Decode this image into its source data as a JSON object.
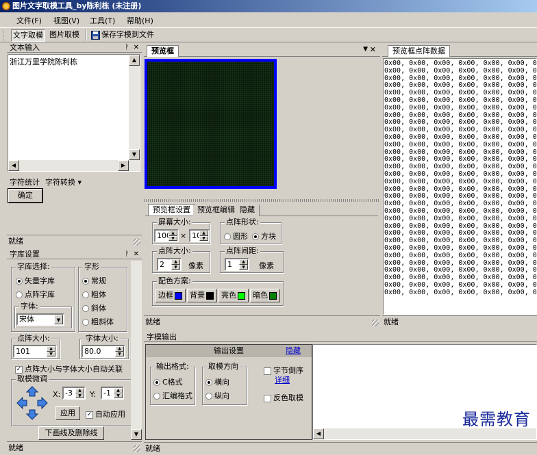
{
  "window": {
    "title": "图片文字取模工具_by陈利栋 (未注册)"
  },
  "menu": [
    "文件(F)",
    "视图(V)",
    "工具(T)",
    "帮助(H)"
  ],
  "toolbar": {
    "btn1": "文字取模",
    "btn2": "图片取模",
    "btn3": "保存字模到文件"
  },
  "text_input": {
    "title": "文本输入",
    "value": "浙江万里学院陈利栋",
    "stat_label": "字符统计",
    "convert_label": "字符转换",
    "ok": "确定",
    "status": "就绪"
  },
  "font_settings": {
    "title": "字库设置",
    "lib_group": "字库选择:",
    "lib_options": [
      "矢量字库",
      "点阵字库"
    ],
    "font_group": "字体:",
    "font_value": "宋体",
    "style_group": "字形",
    "style_options": [
      "常规",
      "粗体",
      "斜体",
      "粗斜体"
    ],
    "dot_size_label": "点阵大小:",
    "dot_size_value": "101",
    "font_size_label": "字体大小:",
    "font_size_value": "80.0",
    "auto_link": "点阵大小与字体大小自动关联",
    "fine_tune": "取模微调",
    "x_label": "X:",
    "x_value": "-3",
    "y_label": "Y:",
    "y_value": "-1",
    "apply": "应用",
    "auto_apply": "自动应用",
    "underline_btn": "下画线及删除线",
    "status": "就绪"
  },
  "preview": {
    "tab": "预览框",
    "status": "就绪",
    "settings_tabs": [
      "预览框设置",
      "预览框编辑",
      "隐藏"
    ],
    "screen_size_label": "屏幕大小:",
    "screen_w": "100",
    "screen_h": "100",
    "times": "×",
    "dot_shape_label": "点阵形状:",
    "dot_shapes": [
      "圆形",
      "方块"
    ],
    "dot_size_label": "点阵大小:",
    "dot_size_value": "2",
    "px1": "像素",
    "dot_gap_label": "点阵间距:",
    "dot_gap_value": "1",
    "px2": "像素",
    "color_label": "配色方案:",
    "colors": [
      {
        "label": "边框",
        "color": "#0000ff"
      },
      {
        "label": "背景",
        "color": "#000000"
      },
      {
        "label": "亮色",
        "color": "#00ff00"
      },
      {
        "label": "暗色",
        "color": "#008000"
      }
    ],
    "screen_border": "#0000ff",
    "screen_bg": "#0b1a0b"
  },
  "dot_data": {
    "tab": "预览框点阵数据",
    "line": "0x00, 0x00, 0x00, 0x00, 0x00, 0x00, 0x00, 0x00, 0",
    "status": "就绪"
  },
  "output": {
    "title": "字模输出",
    "settings_title": "输出设置",
    "hide_link": "隐藏",
    "format_label": "输出格式:",
    "formats": [
      "C格式",
      "汇编格式"
    ],
    "direction_label": "取模方向",
    "directions": [
      "横向",
      "纵向"
    ],
    "byte_reverse": "字节倒序",
    "detail_link": "详细",
    "invert": "反色取模",
    "status": "就绪"
  },
  "watermark": "最需教育"
}
